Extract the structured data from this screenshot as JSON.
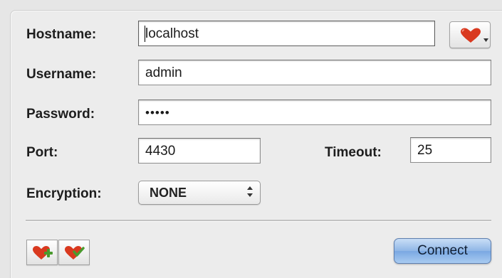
{
  "form": {
    "hostname_label": "Hostname:",
    "hostname_value": "localhost",
    "username_label": "Username:",
    "username_value": "admin",
    "password_label": "Password:",
    "password_value": "•••••",
    "port_label": "Port:",
    "port_value": "4430",
    "timeout_label": "Timeout:",
    "timeout_value": "25",
    "encryption_label": "Encryption:",
    "encryption_value": "NONE"
  },
  "buttons": {
    "connect_label": "Connect"
  },
  "icons": {
    "favorites_menu": "heart-icon",
    "add_favorite": "heart-add-icon",
    "remove_favorite": "heart-remove-icon"
  },
  "colors": {
    "heart_red": "#d9391f",
    "plus_green": "#4a9a2e",
    "connect_blue": "#8fb6e6"
  }
}
